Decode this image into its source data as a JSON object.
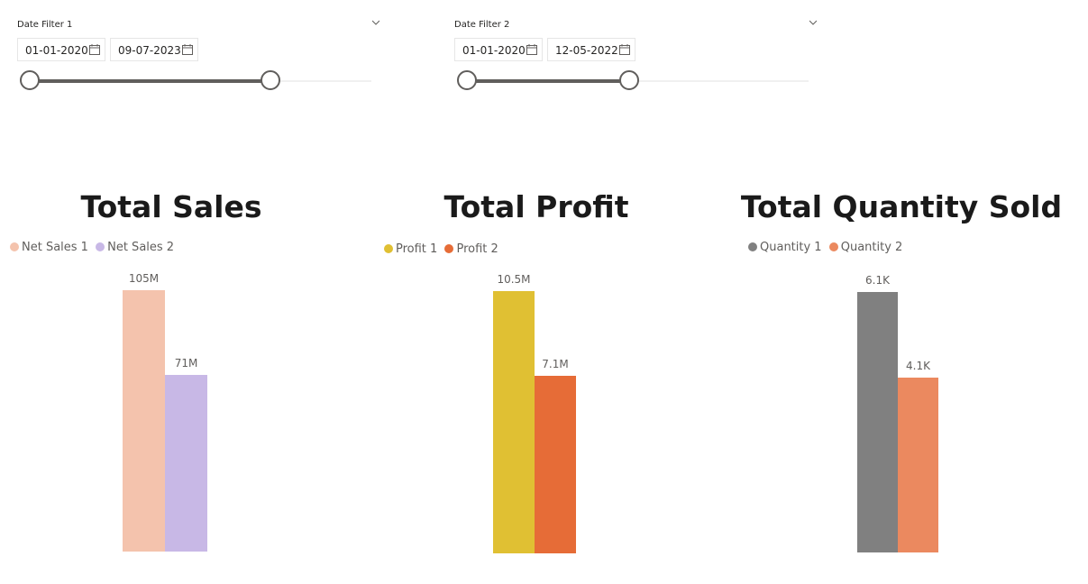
{
  "filters": [
    {
      "title": "Date Filter 1",
      "start": "01-01-2020",
      "end": "09-07-2023",
      "range": [
        0,
        0.7
      ]
    },
    {
      "title": "Date Filter 2",
      "start": "01-01-2020",
      "end": "12-05-2022",
      "range": [
        0,
        0.46
      ]
    }
  ],
  "colors": {
    "net_sales_1": "#f4c3ad",
    "net_sales_2": "#c8b8e6",
    "profit_1": "#e0c033",
    "profit_2": "#e66c37",
    "quantity_1": "#808080",
    "quantity_2": "#eb895f"
  },
  "chart_data": [
    {
      "type": "bar",
      "title": "Total Sales",
      "series": [
        {
          "name": "Net Sales 1",
          "values": [
            105000000
          ],
          "label": "105M",
          "color": "#f4c3ad"
        },
        {
          "name": "Net Sales 2",
          "values": [
            71000000
          ],
          "label": "71M",
          "color": "#c8b8e6"
        }
      ],
      "ylim": [
        0,
        105000000
      ],
      "legend": "top-left"
    },
    {
      "type": "bar",
      "title": "Total Profit",
      "series": [
        {
          "name": "Profit 1",
          "values": [
            10500000
          ],
          "label": "10.5M",
          "color": "#e0c033"
        },
        {
          "name": "Profit 2",
          "values": [
            7100000
          ],
          "label": "7.1M",
          "color": "#e66c37"
        }
      ],
      "ylim": [
        0,
        10500000
      ],
      "legend": "top-left"
    },
    {
      "type": "bar",
      "title": "Total Quantity Sold",
      "series": [
        {
          "name": "Quantity 1",
          "values": [
            6100
          ],
          "label": "6.1K",
          "color": "#808080"
        },
        {
          "name": "Quantity 2",
          "values": [
            4100
          ],
          "label": "4.1K",
          "color": "#eb895f"
        }
      ],
      "ylim": [
        0,
        6100
      ],
      "legend": "top-left"
    }
  ]
}
